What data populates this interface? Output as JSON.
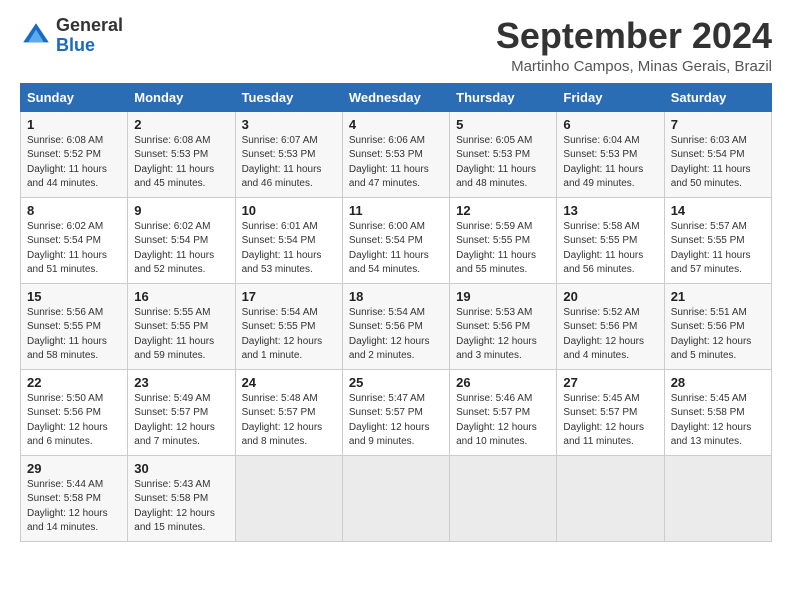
{
  "header": {
    "logo_general": "General",
    "logo_blue": "Blue",
    "month_title": "September 2024",
    "location": "Martinho Campos, Minas Gerais, Brazil"
  },
  "days_of_week": [
    "Sunday",
    "Monday",
    "Tuesday",
    "Wednesday",
    "Thursday",
    "Friday",
    "Saturday"
  ],
  "weeks": [
    [
      {
        "day": "1",
        "sunrise": "6:08 AM",
        "sunset": "5:52 PM",
        "daylight": "11 hours and 44 minutes."
      },
      {
        "day": "2",
        "sunrise": "6:08 AM",
        "sunset": "5:53 PM",
        "daylight": "11 hours and 45 minutes."
      },
      {
        "day": "3",
        "sunrise": "6:07 AM",
        "sunset": "5:53 PM",
        "daylight": "11 hours and 46 minutes."
      },
      {
        "day": "4",
        "sunrise": "6:06 AM",
        "sunset": "5:53 PM",
        "daylight": "11 hours and 47 minutes."
      },
      {
        "day": "5",
        "sunrise": "6:05 AM",
        "sunset": "5:53 PM",
        "daylight": "11 hours and 48 minutes."
      },
      {
        "day": "6",
        "sunrise": "6:04 AM",
        "sunset": "5:53 PM",
        "daylight": "11 hours and 49 minutes."
      },
      {
        "day": "7",
        "sunrise": "6:03 AM",
        "sunset": "5:54 PM",
        "daylight": "11 hours and 50 minutes."
      }
    ],
    [
      {
        "day": "8",
        "sunrise": "6:02 AM",
        "sunset": "5:54 PM",
        "daylight": "11 hours and 51 minutes."
      },
      {
        "day": "9",
        "sunrise": "6:02 AM",
        "sunset": "5:54 PM",
        "daylight": "11 hours and 52 minutes."
      },
      {
        "day": "10",
        "sunrise": "6:01 AM",
        "sunset": "5:54 PM",
        "daylight": "11 hours and 53 minutes."
      },
      {
        "day": "11",
        "sunrise": "6:00 AM",
        "sunset": "5:54 PM",
        "daylight": "11 hours and 54 minutes."
      },
      {
        "day": "12",
        "sunrise": "5:59 AM",
        "sunset": "5:55 PM",
        "daylight": "11 hours and 55 minutes."
      },
      {
        "day": "13",
        "sunrise": "5:58 AM",
        "sunset": "5:55 PM",
        "daylight": "11 hours and 56 minutes."
      },
      {
        "day": "14",
        "sunrise": "5:57 AM",
        "sunset": "5:55 PM",
        "daylight": "11 hours and 57 minutes."
      }
    ],
    [
      {
        "day": "15",
        "sunrise": "5:56 AM",
        "sunset": "5:55 PM",
        "daylight": "11 hours and 58 minutes."
      },
      {
        "day": "16",
        "sunrise": "5:55 AM",
        "sunset": "5:55 PM",
        "daylight": "11 hours and 59 minutes."
      },
      {
        "day": "17",
        "sunrise": "5:54 AM",
        "sunset": "5:55 PM",
        "daylight": "12 hours and 1 minute."
      },
      {
        "day": "18",
        "sunrise": "5:54 AM",
        "sunset": "5:56 PM",
        "daylight": "12 hours and 2 minutes."
      },
      {
        "day": "19",
        "sunrise": "5:53 AM",
        "sunset": "5:56 PM",
        "daylight": "12 hours and 3 minutes."
      },
      {
        "day": "20",
        "sunrise": "5:52 AM",
        "sunset": "5:56 PM",
        "daylight": "12 hours and 4 minutes."
      },
      {
        "day": "21",
        "sunrise": "5:51 AM",
        "sunset": "5:56 PM",
        "daylight": "12 hours and 5 minutes."
      }
    ],
    [
      {
        "day": "22",
        "sunrise": "5:50 AM",
        "sunset": "5:56 PM",
        "daylight": "12 hours and 6 minutes."
      },
      {
        "day": "23",
        "sunrise": "5:49 AM",
        "sunset": "5:57 PM",
        "daylight": "12 hours and 7 minutes."
      },
      {
        "day": "24",
        "sunrise": "5:48 AM",
        "sunset": "5:57 PM",
        "daylight": "12 hours and 8 minutes."
      },
      {
        "day": "25",
        "sunrise": "5:47 AM",
        "sunset": "5:57 PM",
        "daylight": "12 hours and 9 minutes."
      },
      {
        "day": "26",
        "sunrise": "5:46 AM",
        "sunset": "5:57 PM",
        "daylight": "12 hours and 10 minutes."
      },
      {
        "day": "27",
        "sunrise": "5:45 AM",
        "sunset": "5:57 PM",
        "daylight": "12 hours and 11 minutes."
      },
      {
        "day": "28",
        "sunrise": "5:45 AM",
        "sunset": "5:58 PM",
        "daylight": "12 hours and 13 minutes."
      }
    ],
    [
      {
        "day": "29",
        "sunrise": "5:44 AM",
        "sunset": "5:58 PM",
        "daylight": "12 hours and 14 minutes."
      },
      {
        "day": "30",
        "sunrise": "5:43 AM",
        "sunset": "5:58 PM",
        "daylight": "12 hours and 15 minutes."
      },
      null,
      null,
      null,
      null,
      null
    ]
  ]
}
